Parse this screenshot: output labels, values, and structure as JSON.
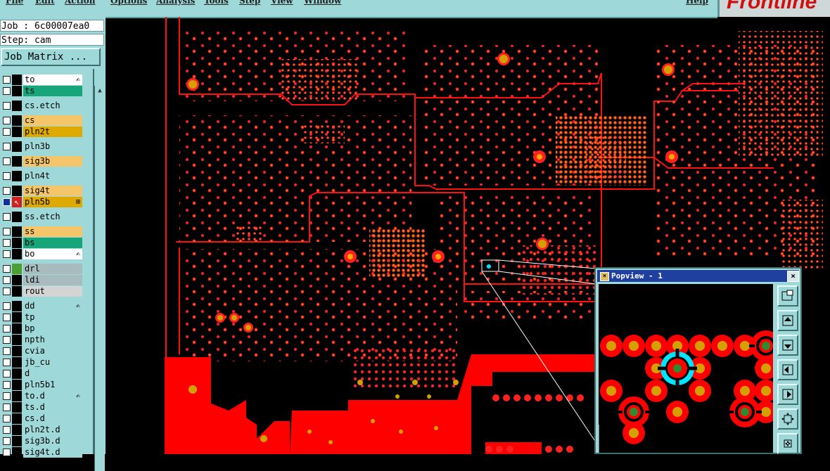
{
  "menu": {
    "items": [
      "File",
      "Edit",
      "Action",
      "Options",
      "Analysis",
      "Tools",
      "Step",
      "View",
      "Window"
    ],
    "help": "Help"
  },
  "brand": {
    "name": "Frontline"
  },
  "job": {
    "label": "Job : 6c00007ea0",
    "step": "Step: cam"
  },
  "job_matrix": {
    "label": "Job Matrix ..."
  },
  "layers": [
    {
      "name": "to",
      "color": "#ffffff",
      "mark": "✍"
    },
    {
      "name": "ts",
      "color": "#17a67a"
    },
    {
      "name": "cs.etch",
      "color": "#9ed8d8"
    },
    {
      "name": "cs",
      "color": "#f5c56a"
    },
    {
      "name": "pln2t",
      "color": "#dfaa00"
    },
    {
      "name": "pln3b",
      "color": "#9ed8d8"
    },
    {
      "name": "sig3b",
      "color": "#f5c56a"
    },
    {
      "name": "pln4t",
      "color": "#9ed8d8"
    },
    {
      "name": "sig4t",
      "color": "#f5c56a"
    },
    {
      "name": "pln5b",
      "color": "#dfaa00",
      "active": true,
      "mark": "⊞"
    },
    {
      "name": "ss.etch",
      "color": "#9ed8d8"
    },
    {
      "name": "ss",
      "color": "#f5c56a"
    },
    {
      "name": "bs",
      "color": "#17a67a"
    },
    {
      "name": "bo",
      "color": "#ffffff",
      "mark": "✍"
    },
    {
      "name": "drl",
      "color": "#a8bcc0",
      "swatch": "#4aa030"
    },
    {
      "name": "ldi",
      "color": "#a8bcc0"
    },
    {
      "name": "rout",
      "color": "#d4d4d4"
    },
    {
      "name": "dd",
      "color": "#9ed8d8",
      "mark": "✍"
    },
    {
      "name": "tp",
      "color": "#9ed8d8"
    },
    {
      "name": "bp",
      "color": "#9ed8d8"
    },
    {
      "name": "npth",
      "color": "#9ed8d8"
    },
    {
      "name": "cvia",
      "color": "#9ed8d8"
    },
    {
      "name": "jb_cu",
      "color": "#9ed8d8"
    },
    {
      "name": "d",
      "color": "#9ed8d8"
    },
    {
      "name": "pln5b1",
      "color": "#9ed8d8"
    },
    {
      "name": "to.d",
      "color": "#9ed8d8",
      "mark": "✍"
    },
    {
      "name": "ts.d",
      "color": "#9ed8d8"
    },
    {
      "name": "cs.d",
      "color": "#9ed8d8"
    },
    {
      "name": "pln2t.d",
      "color": "#9ed8d8"
    },
    {
      "name": "sig3b.d",
      "color": "#9ed8d8"
    },
    {
      "name": "sig4t.d",
      "color": "#9ed8d8"
    }
  ],
  "popview": {
    "title": "Popview - 1",
    "close": "×",
    "tools": [
      "zoom-fit-icon",
      "pan-up-icon",
      "pan-down-icon",
      "pan-left-icon",
      "pan-right-icon",
      "zoom-out-icon",
      "zoom-in-icon"
    ]
  },
  "colors": {
    "panel": "#9ed8d8",
    "pcb_copper": "#ff0000",
    "pad_fill": "#d4a000",
    "highlight": "#00e5ff",
    "via_center": "#2e8b2e"
  }
}
